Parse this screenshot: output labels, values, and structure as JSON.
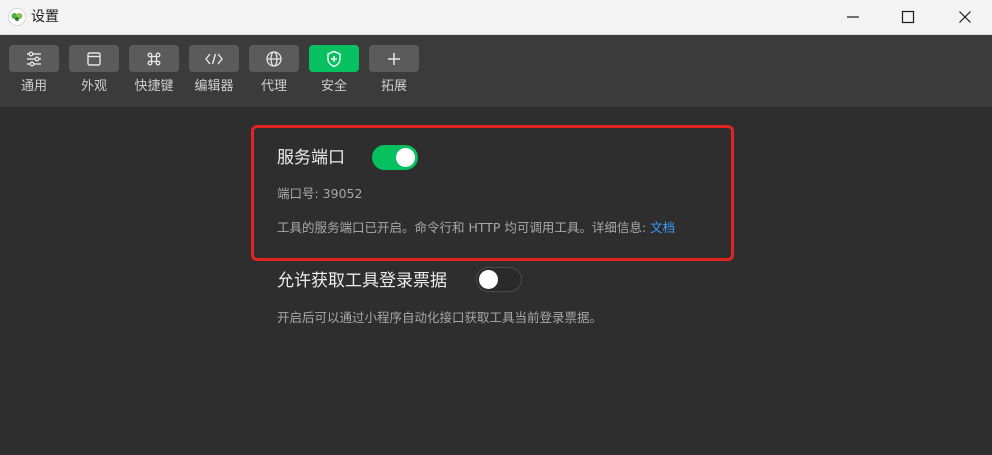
{
  "window": {
    "title": "设置",
    "minimize": "minimize",
    "maximize": "maximize",
    "close": "close"
  },
  "toolbar": {
    "items": [
      {
        "label": "通用",
        "icon": "sliders-icon"
      },
      {
        "label": "外观",
        "icon": "window-icon"
      },
      {
        "label": "快捷键",
        "icon": "command-key-icon"
      },
      {
        "label": "编辑器",
        "icon": "code-brackets-icon"
      },
      {
        "label": "代理",
        "icon": "globe-icon"
      },
      {
        "label": "安全",
        "icon": "shield-icon",
        "active": true
      },
      {
        "label": "拓展",
        "icon": "plus-icon"
      }
    ],
    "active_color": "#07c160"
  },
  "security": {
    "service_port": {
      "title": "服务端口",
      "enabled": true,
      "port_text": "端口号: 39052",
      "desc_text": "工具的服务端口已开启。命令行和 HTTP 均可调用工具。详细信息: ",
      "doc_link": "文档"
    },
    "login_ticket": {
      "title": "允许获取工具登录票据",
      "enabled": false,
      "desc_text": "开启后可以通过小程序自动化接口获取工具当前登录票据。"
    }
  }
}
